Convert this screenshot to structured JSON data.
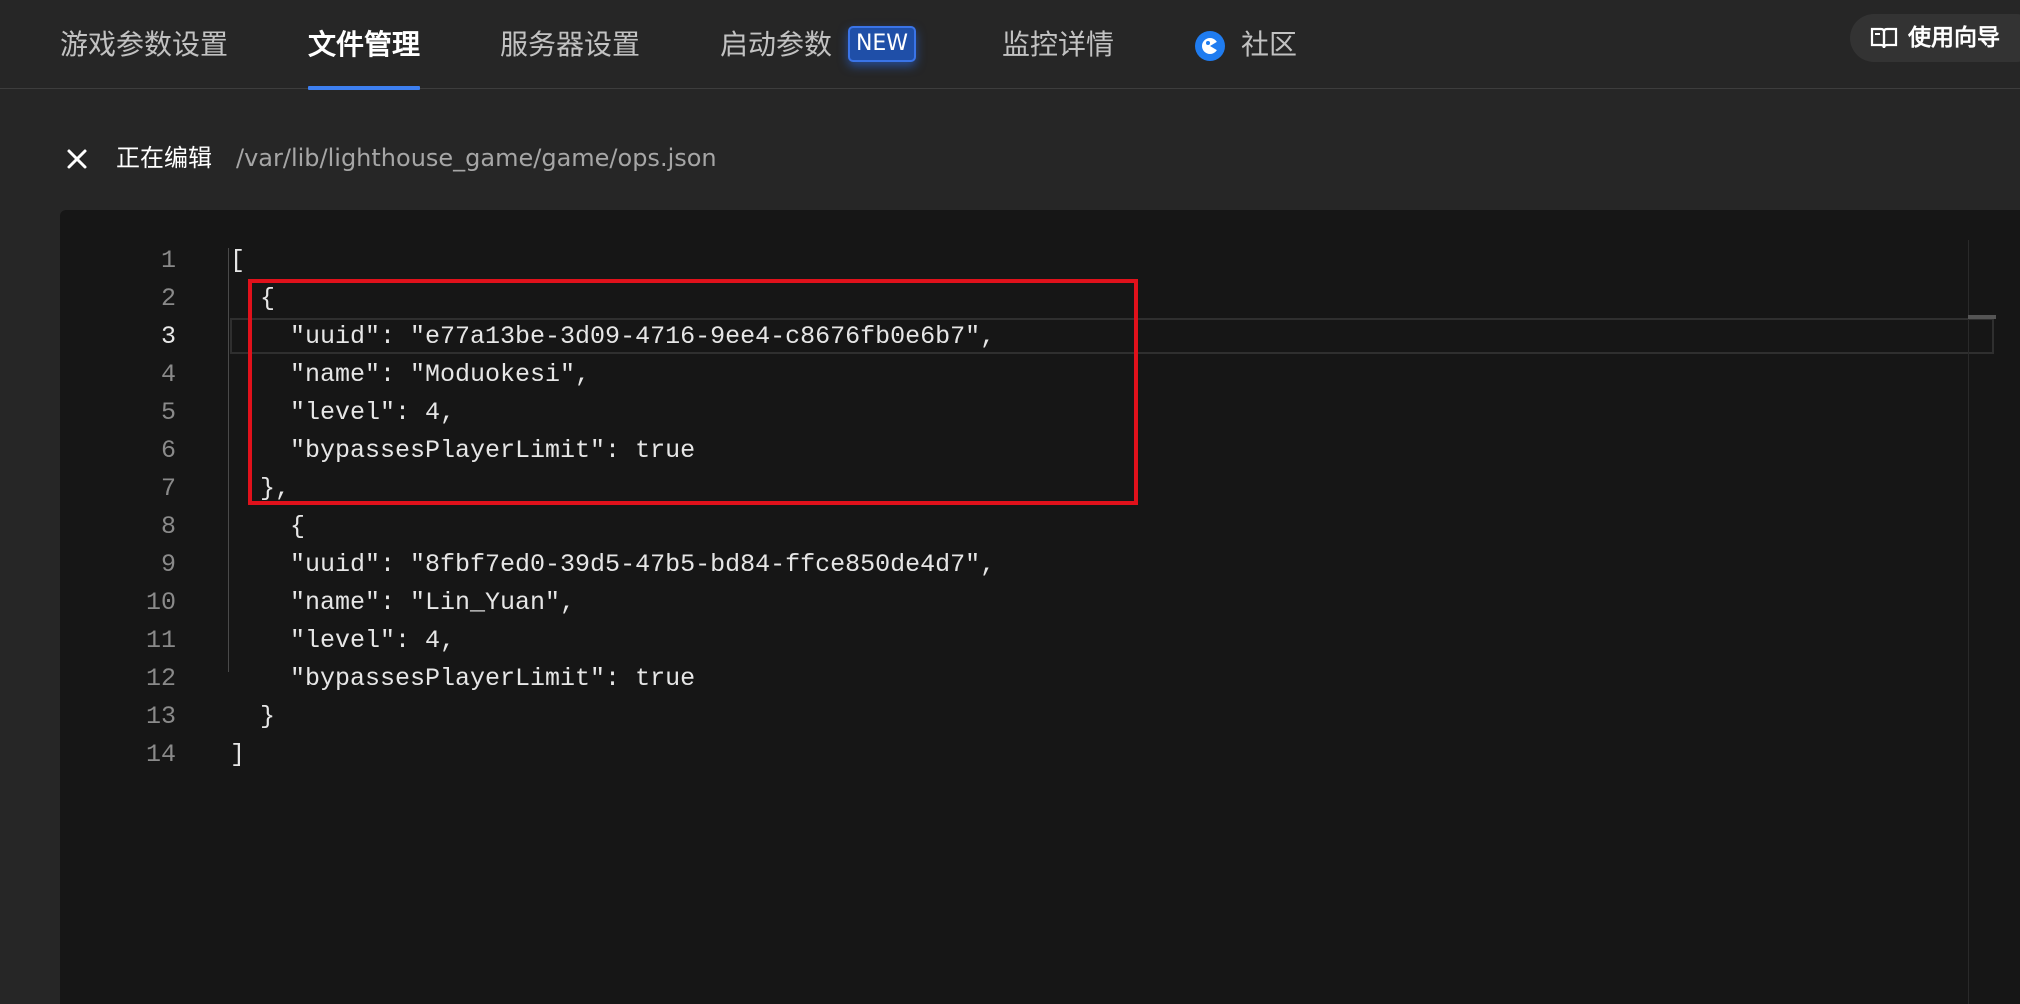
{
  "tabs": [
    {
      "label": "游戏参数设置",
      "active": false
    },
    {
      "label": "文件管理",
      "active": true
    },
    {
      "label": "服务器设置",
      "active": false
    },
    {
      "label": "启动参数",
      "active": false,
      "badge": "NEW"
    },
    {
      "label": "监控详情",
      "active": false
    },
    {
      "label": "社区",
      "active": false,
      "icon": "community-logo-icon"
    }
  ],
  "guide": {
    "label": "使用向导",
    "icon": "book-icon"
  },
  "editing": {
    "label": "正在编辑",
    "path": "/var/lib/lighthouse_game/game/ops.json",
    "close_icon": "close-icon"
  },
  "editor": {
    "current_line": 3,
    "highlighted_lines": "2-7",
    "lines": [
      {
        "number": "1",
        "text": "["
      },
      {
        "number": "2",
        "text": "  {"
      },
      {
        "number": "3",
        "text": "    \"uuid\": \"e77a13be-3d09-4716-9ee4-c8676fb0e6b7\","
      },
      {
        "number": "4",
        "text": "    \"name\": \"Moduokesi\","
      },
      {
        "number": "5",
        "text": "    \"level\": 4,"
      },
      {
        "number": "6",
        "text": "    \"bypassesPlayerLimit\": true"
      },
      {
        "number": "7",
        "text": "  },"
      },
      {
        "number": "8",
        "text": "    {"
      },
      {
        "number": "9",
        "text": "    \"uuid\": \"8fbf7ed0-39d5-47b5-bd84-ffce850de4d7\","
      },
      {
        "number": "10",
        "text": "    \"name\": \"Lin_Yuan\","
      },
      {
        "number": "11",
        "text": "    \"level\": 4,"
      },
      {
        "number": "12",
        "text": "    \"bypassesPlayerLimit\": true"
      },
      {
        "number": "13",
        "text": "  }"
      },
      {
        "number": "14",
        "text": "]"
      }
    ]
  },
  "colors": {
    "background": "#262626",
    "editor_background": "#161616",
    "accent": "#3d7ff0",
    "highlight_box": "#e0111b"
  }
}
